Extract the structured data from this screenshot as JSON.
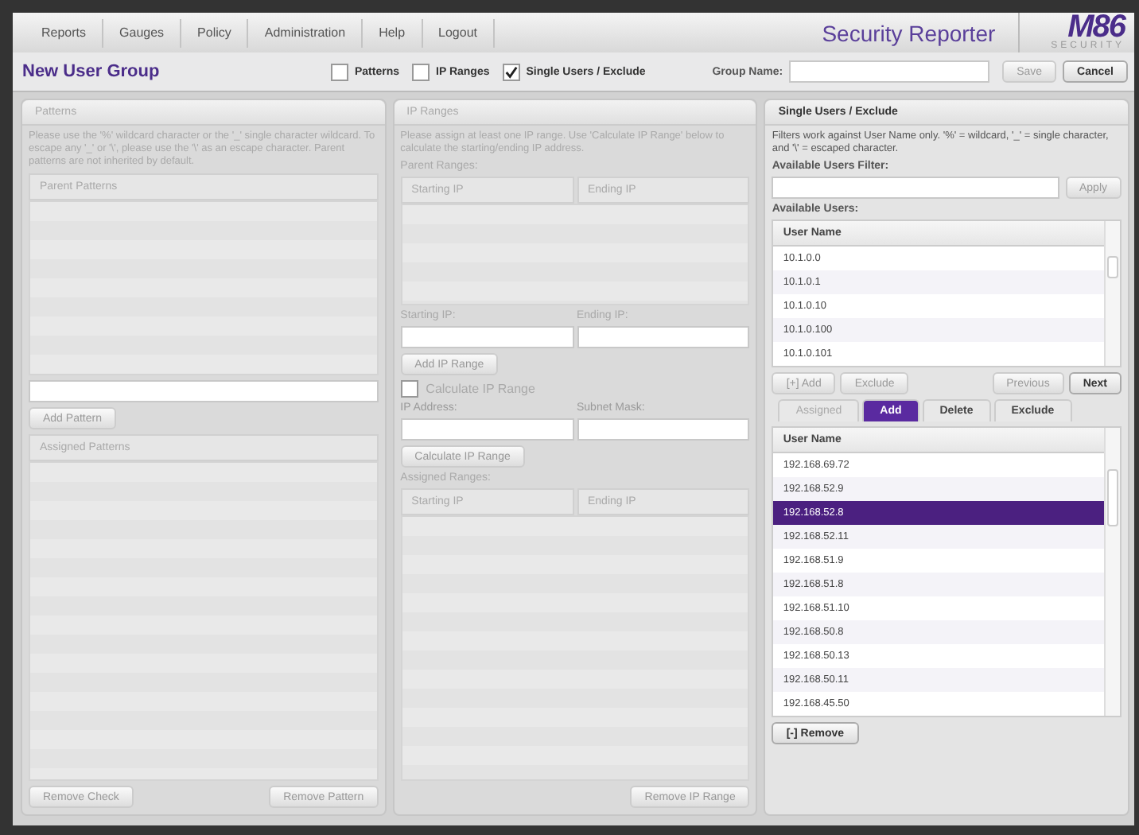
{
  "nav": [
    "Reports",
    "Gauges",
    "Policy",
    "Administration",
    "Help",
    "Logout"
  ],
  "product_title": "Security Reporter",
  "logo": {
    "mark": "M86",
    "subtext": "SECURITY"
  },
  "toolbar": {
    "title": "New User Group",
    "options": [
      {
        "label": "Patterns",
        "checked": false
      },
      {
        "label": "IP Ranges",
        "checked": false
      },
      {
        "label": "Single Users / Exclude",
        "checked": true
      }
    ],
    "group_name_label": "Group Name:",
    "buttons": [
      {
        "label": "Save",
        "disabled": true
      },
      {
        "label": "Cancel",
        "disabled": false
      }
    ]
  },
  "patterns_panel": {
    "title": "Patterns",
    "disabled": true,
    "description": "Please use the '%' wildcard character or the '_' single character wildcard. To escape any '_' or '\\', please use the '\\' as an escape character. Parent patterns are not inherited by default.",
    "parent_table": "Parent Patterns",
    "add_button": "Add Pattern",
    "assigned_table": "Assigned Patterns",
    "bottom_buttons": [
      "Remove Check",
      "Remove Pattern"
    ]
  },
  "ip_ranges_panel": {
    "title": "IP Ranges",
    "disabled": true,
    "description": "Please assign at least one IP range. Use 'Calculate IP Range' below to calculate the starting/ending IP address.",
    "parent_label": "Parent Ranges:",
    "columns": [
      "Starting IP",
      "Ending IP"
    ],
    "start_label": "Starting IP:",
    "end_label": "Ending IP:",
    "add_button": "Add IP Range",
    "calculate": {
      "label": "Calculate IP Range",
      "checked": false
    },
    "ip_label": "IP Address:",
    "mask_label": "Subnet Mask:",
    "calculate_button": "Calculate IP Range",
    "assigned_label": "Assigned Ranges:",
    "assigned_columns": [
      "Starting IP",
      "Ending IP"
    ],
    "remove_button": "Remove IP Range"
  },
  "users_panel": {
    "title": "Single Users / Exclude",
    "disabled": false,
    "description": "Filters work against User Name only. '%' = wildcard, '_' = single character, and '\\' = escaped character.",
    "filter_label": "Available Users Filter:",
    "apply_button": "Apply",
    "available_label": "Available Users:",
    "available_column": "User Name",
    "available_rows": [
      "10.1.0.0",
      "10.1.0.1",
      "10.1.0.10",
      "10.1.0.100",
      "10.1.0.101"
    ],
    "nav_buttons": [
      {
        "label": "[+] Add",
        "disabled": true
      },
      {
        "label": "Exclude",
        "disabled": true
      },
      {
        "label": "Previous",
        "disabled": true
      },
      {
        "label": "Next",
        "disabled": false
      }
    ],
    "tabs": [
      {
        "label": "Assigned",
        "selected": false,
        "disabled": true
      },
      {
        "label": "Add",
        "selected": true,
        "disabled": false
      },
      {
        "label": "Delete",
        "selected": false,
        "disabled": false
      },
      {
        "label": "Exclude",
        "selected": false,
        "disabled": false
      }
    ],
    "assigned_column": "User Name",
    "assigned_rows": [
      {
        "name": "192.168.69.72",
        "selected": false
      },
      {
        "name": "192.168.52.9",
        "selected": false
      },
      {
        "name": "192.168.52.8",
        "selected": true
      },
      {
        "name": "192.168.52.11",
        "selected": false
      },
      {
        "name": "192.168.51.9",
        "selected": false
      },
      {
        "name": "192.168.51.8",
        "selected": false
      },
      {
        "name": "192.168.51.10",
        "selected": false
      },
      {
        "name": "192.168.50.8",
        "selected": false
      },
      {
        "name": "192.168.50.13",
        "selected": false
      },
      {
        "name": "192.168.50.11",
        "selected": false
      },
      {
        "name": "192.168.45.50",
        "selected": false
      }
    ],
    "remove_button": "[-] Remove"
  }
}
